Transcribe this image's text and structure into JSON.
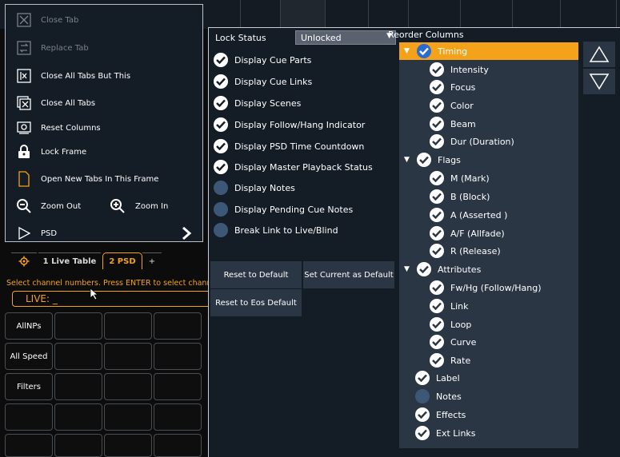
{
  "menu": {
    "items": [
      {
        "label": "Close Tab",
        "icon": "close-tab-icon",
        "disabled": true
      },
      {
        "label": "Replace Tab",
        "icon": "replace-tab-icon",
        "disabled": true
      },
      {
        "label": "Close All Tabs But This",
        "icon": "close-all-but-this-icon",
        "disabled": false
      },
      {
        "label": "Close All Tabs",
        "icon": "close-all-tabs-icon",
        "disabled": false
      },
      {
        "label": "Reset Columns",
        "icon": "reset-columns-icon",
        "disabled": false
      },
      {
        "label": "Lock Frame",
        "icon": "lock-icon",
        "disabled": false
      },
      {
        "label": "Open New Tabs In This Frame",
        "icon": "document-icon",
        "disabled": false
      },
      {
        "label": "Zoom Out",
        "icon": "zoom-out-icon",
        "disabled": false
      },
      {
        "label": "PSD",
        "icon": "play-icon",
        "disabled": false
      }
    ],
    "zoom_in_label": "Zoom In"
  },
  "tabs": [
    {
      "label": "1 Live Table"
    },
    {
      "label": "2 PSD",
      "active": true
    },
    {
      "label": "+"
    }
  ],
  "command_line": {
    "prompt": "Select channel numbers.  Press ENTER to select channels",
    "value": "LIVE:  _"
  },
  "grid_buttons": [
    "AllNPs",
    "All Speed",
    "Filters"
  ],
  "psd_settings": {
    "lock_status_label": "Lock Status",
    "lock_status_value": "Unlocked",
    "options": [
      {
        "label": "Display Cue Parts",
        "checked": true
      },
      {
        "label": "Display Cue Links",
        "checked": true
      },
      {
        "label": "Display Scenes",
        "checked": true
      },
      {
        "label": "Display Follow/Hang Indicator",
        "checked": true
      },
      {
        "label": "Display PSD Time Countdown",
        "checked": true
      },
      {
        "label": "Display Master Playback Status",
        "checked": true
      },
      {
        "label": "Display Notes",
        "checked": false
      },
      {
        "label": "Display Pending Cue Notes",
        "checked": false
      },
      {
        "label": "Break Link to Live/Blind",
        "checked": false
      }
    ],
    "buttons": {
      "reset_default": "Reset to Default",
      "set_current_default": "Set Current as Default",
      "reset_eos_default": "Reset to Eos Default"
    },
    "reorder_label": "Reorder Columns",
    "tree": [
      {
        "label": "Timing",
        "level": 0,
        "checked": true,
        "expander": true,
        "selected": true
      },
      {
        "label": "Intensity",
        "level": 1,
        "checked": true
      },
      {
        "label": "Focus",
        "level": 1,
        "checked": true
      },
      {
        "label": "Color",
        "level": 1,
        "checked": true
      },
      {
        "label": "Beam",
        "level": 1,
        "checked": true
      },
      {
        "label": "Dur (Duration)",
        "level": 1,
        "checked": true
      },
      {
        "label": "Flags",
        "level": 0,
        "checked": true,
        "expander": true
      },
      {
        "label": "M (Mark)",
        "level": 1,
        "checked": true
      },
      {
        "label": "B (Block)",
        "level": 1,
        "checked": true
      },
      {
        "label": "A (Asserted )",
        "level": 1,
        "checked": true
      },
      {
        "label": "A/F (Allfade)",
        "level": 1,
        "checked": true
      },
      {
        "label": "R (Release)",
        "level": 1,
        "checked": true
      },
      {
        "label": "Attributes",
        "level": 0,
        "checked": true,
        "expander": true
      },
      {
        "label": "Fw/Hg (Follow/Hang)",
        "level": 1,
        "checked": true
      },
      {
        "label": "Link",
        "level": 1,
        "checked": true
      },
      {
        "label": "Loop",
        "level": 1,
        "checked": true
      },
      {
        "label": "Curve",
        "level": 1,
        "checked": true
      },
      {
        "label": "Rate",
        "level": 1,
        "checked": true
      },
      {
        "label": "Label",
        "level": 0,
        "checked": true
      },
      {
        "label": "Notes",
        "level": 0,
        "checked": false
      },
      {
        "label": "Effects",
        "level": 0,
        "checked": true
      },
      {
        "label": "Ext Links",
        "level": 0,
        "checked": true
      }
    ]
  },
  "colors": {
    "accent": "#f4a21a",
    "panel": "#141c26",
    "tree_bg": "#2b3645",
    "selected_check": "#2a6bd1"
  }
}
